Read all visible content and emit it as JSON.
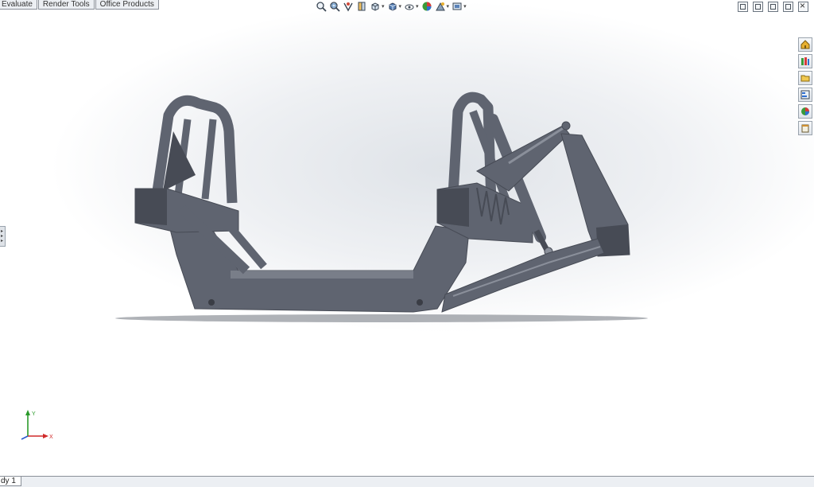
{
  "command_tabs": [
    {
      "label": "Evaluate"
    },
    {
      "label": "Render Tools"
    },
    {
      "label": "Office Products"
    }
  ],
  "heads_up_toolbar": [
    {
      "icon": "zoom-to-fit-icon"
    },
    {
      "icon": "zoom-to-area-icon"
    },
    {
      "icon": "previous-view-icon"
    },
    {
      "icon": "section-view-icon"
    },
    {
      "icon": "view-orientation-icon"
    },
    {
      "icon": "display-style-icon"
    },
    {
      "icon": "hide-show-items-icon"
    },
    {
      "icon": "edit-appearance-icon"
    },
    {
      "icon": "apply-scene-icon"
    },
    {
      "icon": "view-settings-icon"
    }
  ],
  "task_pane": [
    {
      "icon": "solidworks-resources-icon"
    },
    {
      "icon": "design-library-icon"
    },
    {
      "icon": "file-explorer-icon"
    },
    {
      "icon": "view-palette-icon"
    },
    {
      "icon": "appearances-scenes-icon"
    },
    {
      "icon": "custom-properties-icon"
    }
  ],
  "triad": {
    "x_label": "X",
    "y_label": "Y"
  },
  "status": {
    "sheet_tab": "dy 1"
  },
  "colors": {
    "model": "#5f6470",
    "model_dark": "#474b55",
    "model_light": "#8a8f9a",
    "shadow": "#6e737c"
  }
}
